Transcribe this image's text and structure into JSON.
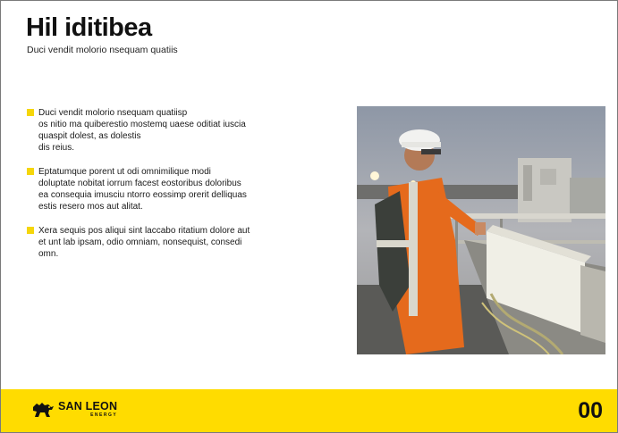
{
  "slide": {
    "title": "Hil iditibea",
    "subtitle": "Duci vendit molorio nsequam quatiis",
    "bullets": [
      {
        "text": "Duci vendit molorio nsequam quatiisp\nos nitio ma quiberestio mostemq uaese oditiat iuscia\nquaspit dolest, as dolestis\ndis reius."
      },
      {
        "text": "Eptatumque porent ut odi omnimilique modi\ndoluptate nobitat iorrum facest eostoribus doloribus\nea consequia imusciu ntorro eossimp orerit delliquas\nestis resero mos aut alitat."
      },
      {
        "text": "Xera sequis pos aliqui sint laccabo ritatium dolore aut\net unt lab ipsam, odio omniam, nonsequist, consedi\nomn."
      }
    ]
  },
  "footer": {
    "logo_name": "SAN LEON",
    "logo_sub": "ENERGY",
    "page_number": "00"
  },
  "colors": {
    "accent": "#ffdc00",
    "bullet": "#f5d60a",
    "text": "#111111"
  },
  "icons": {
    "logo": "lion-icon",
    "bullet": "square-bullet-icon"
  }
}
